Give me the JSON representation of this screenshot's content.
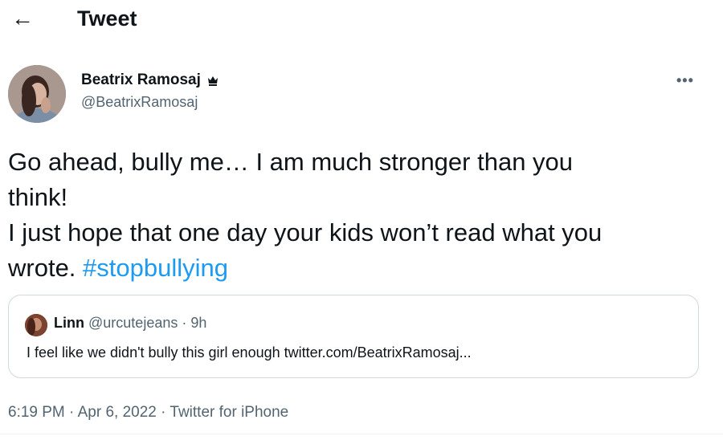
{
  "header": {
    "back_glyph": "←",
    "title": "Tweet"
  },
  "author": {
    "display_name": "Beatrix Ramosaj",
    "handle": "@BeatrixRamosaj",
    "badge_icon": "crown-icon"
  },
  "more_glyph": "•••",
  "tweet": {
    "line1": "Go ahead, bully me… I am much stronger than you",
    "line2": "think!",
    "line3": "I just hope that one day your kids won’t read what you",
    "line4_prefix": "wrote. ",
    "hashtag": "#stopbullying"
  },
  "quoted": {
    "name": "Linn",
    "handle_time": "@urcutejeans · 9h",
    "text": "I feel like we didn't bully this girl enough twitter.com/BeatrixRamosaj..."
  },
  "meta": {
    "time": "6:19 PM",
    "sep1": " · ",
    "date": "Apr 6, 2022",
    "sep2": " · ",
    "source": "Twitter for iPhone"
  },
  "colors": {
    "link": "#1d9bf0",
    "secondary_text": "#536471",
    "border": "#cfd9de"
  }
}
